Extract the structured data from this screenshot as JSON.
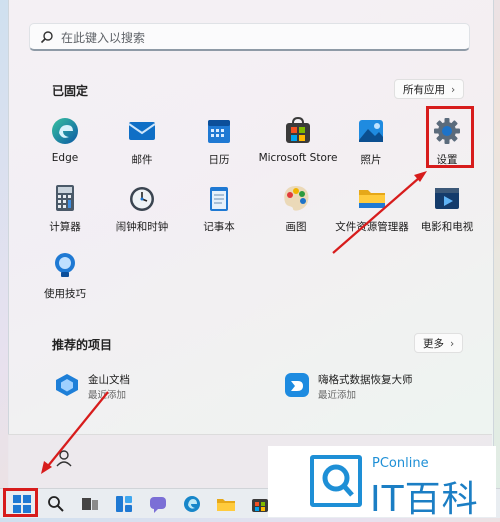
{
  "search": {
    "placeholder": "在此键入以搜索"
  },
  "pinned": {
    "title": "已固定",
    "all_apps_label": "所有应用",
    "apps": [
      {
        "label": "Edge",
        "icon": "edge-icon"
      },
      {
        "label": "邮件",
        "icon": "mail-icon"
      },
      {
        "label": "日历",
        "icon": "calendar-icon"
      },
      {
        "label": "Microsoft Store",
        "icon": "store-icon"
      },
      {
        "label": "照片",
        "icon": "photos-icon"
      },
      {
        "label": "设置",
        "icon": "gear-icon"
      },
      {
        "label": "计算器",
        "icon": "calculator-icon"
      },
      {
        "label": "闹钟和时钟",
        "icon": "clock-icon"
      },
      {
        "label": "记事本",
        "icon": "notepad-icon"
      },
      {
        "label": "画图",
        "icon": "paint-icon"
      },
      {
        "label": "文件资源管理器",
        "icon": "folder-icon"
      },
      {
        "label": "电影和电视",
        "icon": "movies-icon"
      },
      {
        "label": "使用技巧",
        "icon": "tips-icon"
      }
    ]
  },
  "recommended": {
    "title": "推荐的项目",
    "more_label": "更多",
    "items": [
      {
        "title": "金山文档",
        "subtitle": "最近添加",
        "icon": "kdocs-icon"
      },
      {
        "title": "嗨格式数据恢复大师",
        "subtitle": "最近添加",
        "icon": "recovery-icon"
      }
    ]
  },
  "watermark": {
    "brand": "PConline",
    "big_text": "IT百科"
  },
  "colors": {
    "highlight": "#d71c1c",
    "accent": "#0a64c0"
  }
}
